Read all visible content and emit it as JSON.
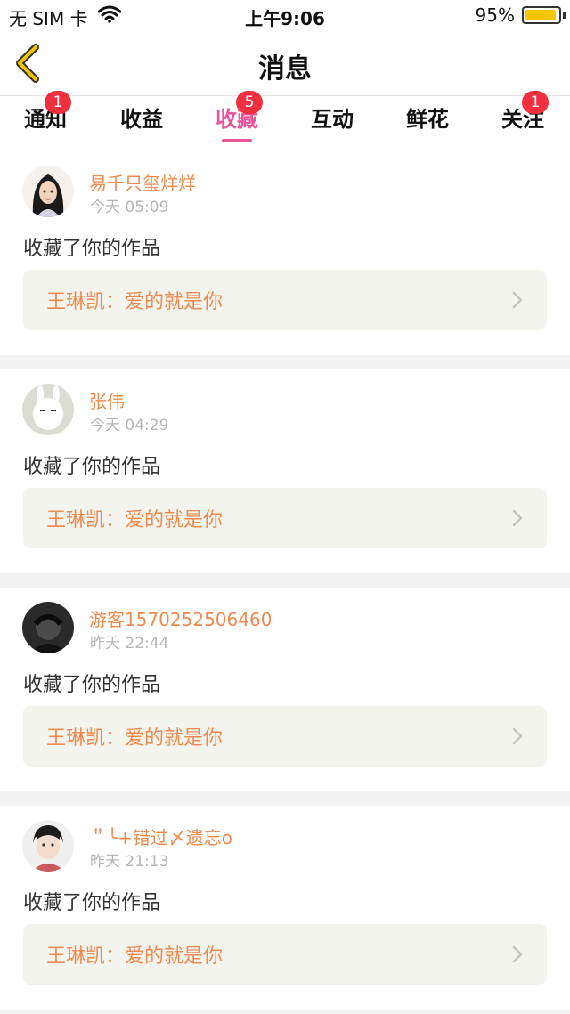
{
  "status_bar": {
    "carrier": "无 SIM 卡",
    "time": "上午9:06",
    "battery_text": "95%",
    "battery_level": 0.95
  },
  "nav": {
    "title": "消息",
    "back_icon": "chevron-left-icon"
  },
  "tabs": [
    {
      "label": "通知",
      "badge": "1"
    },
    {
      "label": "收益",
      "badge": ""
    },
    {
      "label": "收藏",
      "badge": "5",
      "active": true
    },
    {
      "label": "互动",
      "badge": ""
    },
    {
      "label": "鲜花",
      "badge": ""
    },
    {
      "label": "关注",
      "badge": "1"
    }
  ],
  "items": [
    {
      "user": "易千只玺烊烊",
      "time": "今天 05:09",
      "action": "收藏了你的作品",
      "work": "王琳凯：爱的就是你"
    },
    {
      "user": "张伟",
      "time": "今天 04:29",
      "action": "收藏了你的作品",
      "work": "王琳凯：爱的就是你"
    },
    {
      "user": "游客1570252506460",
      "time": "昨天 22:44",
      "action": "收藏了你的作品",
      "work": "王琳凯：爱的就是你"
    },
    {
      "user": "＂╰+错过〆遗忘o",
      "time": "昨天 21:13",
      "action": "收藏了你的作品",
      "work": "王琳凯：爱的就是你"
    }
  ],
  "colors": {
    "accent": "#e9539a",
    "badge": "#f0303f",
    "username": "#ef8a4f",
    "back_arrow": "#f2c400"
  }
}
